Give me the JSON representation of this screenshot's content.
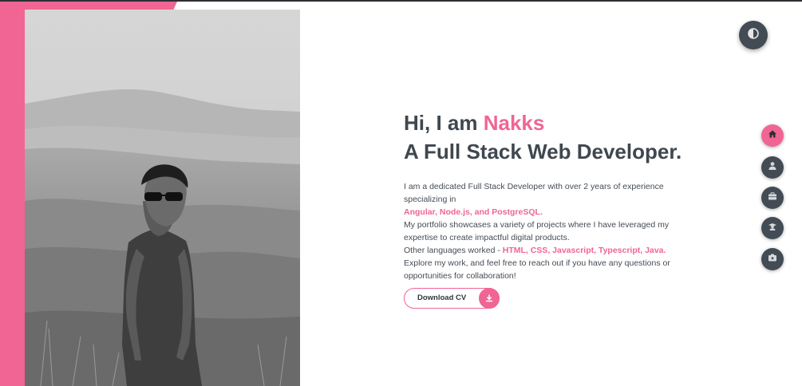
{
  "hero": {
    "greeting_prefix": "Hi, I am ",
    "name": "Nakks",
    "role": "A Full Stack Web Developer.",
    "line1": "I am a dedicated Full Stack Developer with over 2 years of experience specializing in",
    "skills": "Angular, Node.js, and PostgreSQL.",
    "line2": "My portfolio showcases a variety of projects where I have leveraged my expertise to create impactful digital products.",
    "other_prefix": "Other languages worked - ",
    "other_langs": "HTML, CSS, Javascript, Typescript, Java.",
    "line3": "Explore my work, and feel free to reach out if you have any questions or opportunities for collaboration!"
  },
  "cv_button": {
    "label": "Download CV",
    "icon": "download-icon"
  },
  "theme_toggle": {
    "icon": "contrast-icon"
  },
  "nav": [
    {
      "icon": "home-icon",
      "active": true
    },
    {
      "icon": "user-icon",
      "active": false
    },
    {
      "icon": "briefcase-icon",
      "active": false
    },
    {
      "icon": "graduate-icon",
      "active": false
    },
    {
      "icon": "contact-icon",
      "active": false
    }
  ],
  "colors": {
    "accent": "#f06593",
    "dark": "#434b54",
    "text": "#3f474f"
  }
}
